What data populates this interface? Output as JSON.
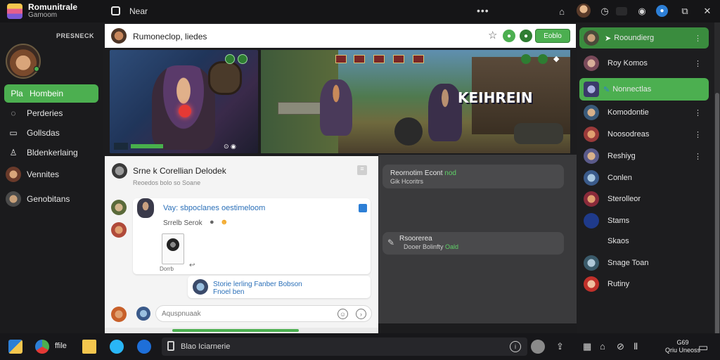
{
  "app": {
    "brand_title": "Romunitrale",
    "brand_subtitle": "Gamoom",
    "window_title": "Near"
  },
  "colors": {
    "accent_green": "#4caf50",
    "dark_bg": "#1c1c1e",
    "link_blue": "#2a6fb8"
  },
  "topbar": {
    "more_icon": "more-horizontal-icon",
    "icons": [
      "home-icon",
      "user-avatar",
      "clock-icon",
      "toggle-icon",
      "eye-icon",
      "notification-icon",
      "window-icon",
      "close-icon"
    ]
  },
  "sidebar": {
    "header": "PRESNECK",
    "items": [
      {
        "label": "Hombein",
        "prefix": "Pla",
        "icon": "home-icon",
        "active": true
      },
      {
        "label": "Perderies",
        "icon": "chat-icon",
        "active": false
      },
      {
        "label": "Gollsdas",
        "icon": "window-icon",
        "active": false
      },
      {
        "label": "Bldenkerlaing",
        "icon": "person-icon",
        "active": false
      },
      {
        "label": "Vennites",
        "icon": "avatar",
        "active": false
      },
      {
        "label": "Genobitans",
        "icon": "avatar",
        "active": false
      }
    ]
  },
  "channel": {
    "title": "Rumoneclop, liedes",
    "follow_button": "Eoblo",
    "star_icon": "star-icon"
  },
  "game": {
    "banner_text": "KEIHREIN"
  },
  "post": {
    "title": "Srne k Corellian Delodek",
    "subtitle": "Reoedos bolo so Soane",
    "message_title": "Vay: sbpoclanes oestimeloom",
    "message_sub": "Srrelb  Serok",
    "attachment_label": "Dorrb",
    "reply_line1": "Storie lerling Fanber Bobson",
    "reply_line2": "Fnoel ben",
    "compose_placeholder": "Aquspnuaak"
  },
  "dark_panel": {
    "card1_line1_a": "Reornotim Econt",
    "card1_line1_b": "nod",
    "card1_line2": "Gik Hcoritrs",
    "card2_line1": "Rsoorerea",
    "card2_line2_a": "Dooer Bolinfty",
    "card2_line2_b": "Oald"
  },
  "right_panel": {
    "items": [
      {
        "label": "Rooundierg",
        "active": true,
        "more": true
      },
      {
        "label": "Roy Komos",
        "active": false,
        "more": true
      },
      {
        "label": "Nonnectlas",
        "active": true,
        "more": false
      },
      {
        "label": "Komodontie",
        "active": false,
        "more": true
      },
      {
        "label": "Noosodreas",
        "active": false,
        "more": true
      },
      {
        "label": "Reshiyg",
        "active": false,
        "more": true
      },
      {
        "label": "Conlen",
        "active": false,
        "more": false
      },
      {
        "label": "Sterolleor",
        "active": false,
        "more": false
      },
      {
        "label": "Stams",
        "active": false,
        "more": false
      },
      {
        "label": "Skaos",
        "active": false,
        "more": false
      },
      {
        "label": "Snage Toan",
        "active": false,
        "more": false
      },
      {
        "label": "Rutiny",
        "active": false,
        "more": false
      }
    ]
  },
  "taskbar": {
    "app_label": "ffile",
    "search_text": "Blao Iciarnerie",
    "clock_line1": "G69",
    "clock_line2": "Qriu Uneoss"
  }
}
